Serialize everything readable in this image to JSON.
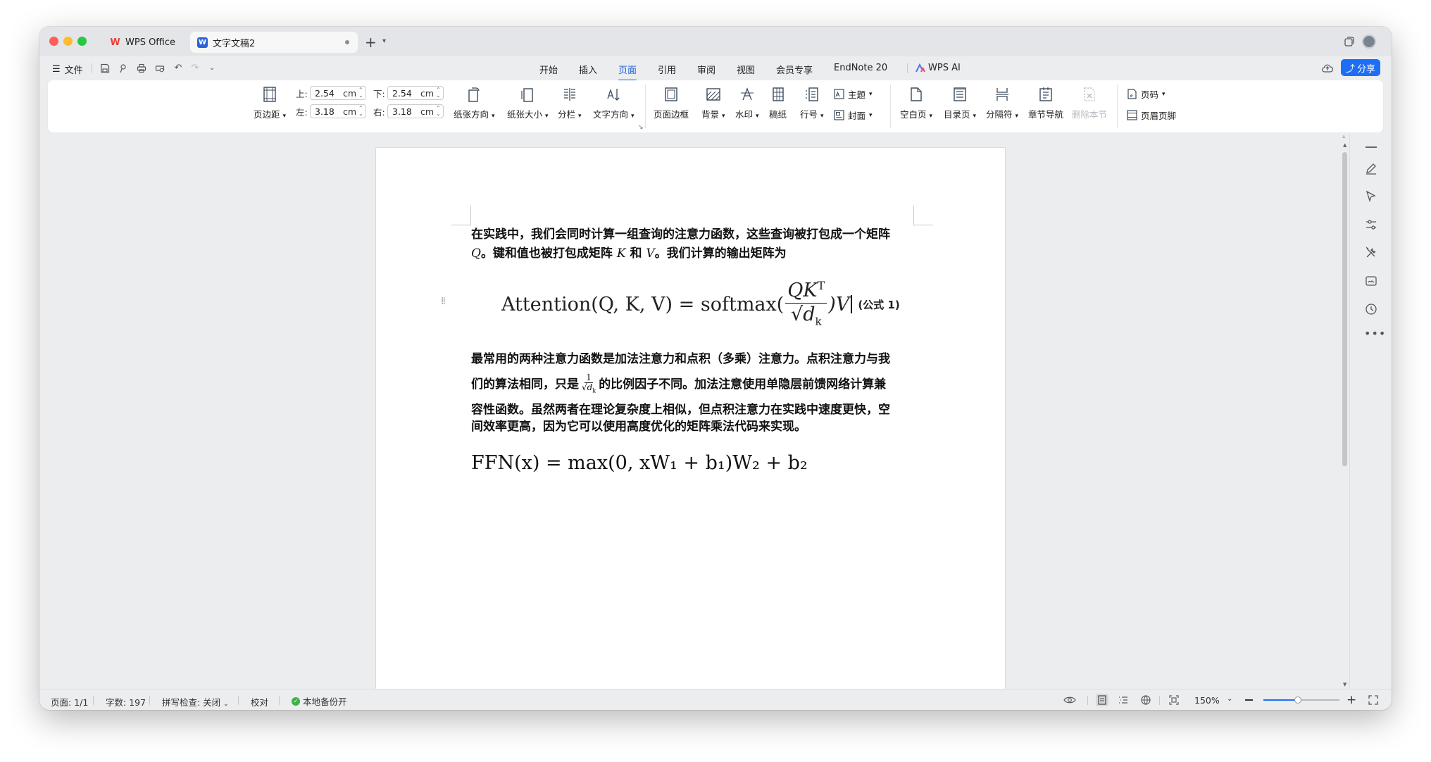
{
  "tabs": {
    "wps_label": "WPS Office",
    "doc_label": "文字文稿2"
  },
  "menu": {
    "file_label": "文件",
    "items": [
      "开始",
      "插入",
      "页面",
      "引用",
      "审阅",
      "视图",
      "会员专享",
      "EndNote 20"
    ],
    "active_index": 2,
    "wps_ai_label": "WPS AI",
    "share_label": "分享"
  },
  "ribbon": {
    "margins_label": "页边距",
    "margin_top_label": "上:",
    "margin_top_value": "2.54",
    "margin_bottom_label": "下:",
    "margin_bottom_value": "2.54",
    "margin_left_label": "左:",
    "margin_left_value": "3.18",
    "margin_right_label": "右:",
    "margin_right_value": "3.18",
    "unit": "cm",
    "orientation_label": "纸张方向",
    "size_label": "纸张大小",
    "columns_label": "分栏",
    "text_direction_label": "文字方向",
    "page_border_label": "页面边框",
    "background_label": "背景",
    "watermark_label": "水印",
    "manuscript_label": "稿纸",
    "line_number_label": "行号",
    "theme_label": "主题",
    "cover_label": "封面",
    "blank_page_label": "空白页",
    "toc_page_label": "目录页",
    "separator_label": "分隔符",
    "chapter_nav_label": "章节导航",
    "delete_section_label": "删除本节",
    "page_number_label": "页码",
    "header_footer_label": "页眉页脚"
  },
  "document": {
    "para1_line1": "在实践中，我们会同时计算一组查询的注意力函数，这些查询被打包成一个矩阵",
    "para1_line2_a": "Q",
    "para1_line2_b": "。键和值也被打包成矩阵 ",
    "para1_line2_c": "K",
    "para1_line2_d": " 和 ",
    "para1_line2_e": "V",
    "para1_line2_f": "。我们计算的输出矩阵为",
    "eq1_lhs": "Attention(Q, K, V) = softmax(",
    "eq1_num": "QK",
    "eq1_sup": "T",
    "eq1_den": "√d",
    "eq1_sub": "k",
    "eq1_rhs": ")V",
    "eq1_label": "(公式 1)",
    "para2_line1": "最常用的两种注意力函数是加法注意力和点积（多乘）注意力。点积注意力与我",
    "para2_line2_a": "们的算法相同，只是",
    "para2_line2_frac_num": "1",
    "para2_line2_frac_den": "√d",
    "para2_line2_frac_sub": "k",
    "para2_line2_b": "的比例因子不同。加法注意使用单隐层前馈网络计算兼",
    "para2_line3": "容性函数。虽然两者在理论复杂度上相似，但点积注意力在实践中速度更快，空",
    "para2_line4": "间效率更高，因为它可以使用高度优化的矩阵乘法代码来实现。",
    "eq2": "FFN(x) = max(0, xW₁ + b₁)W₂ + b₂"
  },
  "status": {
    "page": "页面: 1/1",
    "word_count": "字数: 197",
    "spell_check": "拼写检查: 关闭",
    "proofread": "校对",
    "backup": "本地备份开",
    "zoom": "150%",
    "zoom_fraction": 0.45
  },
  "colors": {
    "accent": "#1e6ef5",
    "wps_red": "#e8413b",
    "doc_blue": "#2b63d9",
    "backup_green": "#3bb346"
  }
}
